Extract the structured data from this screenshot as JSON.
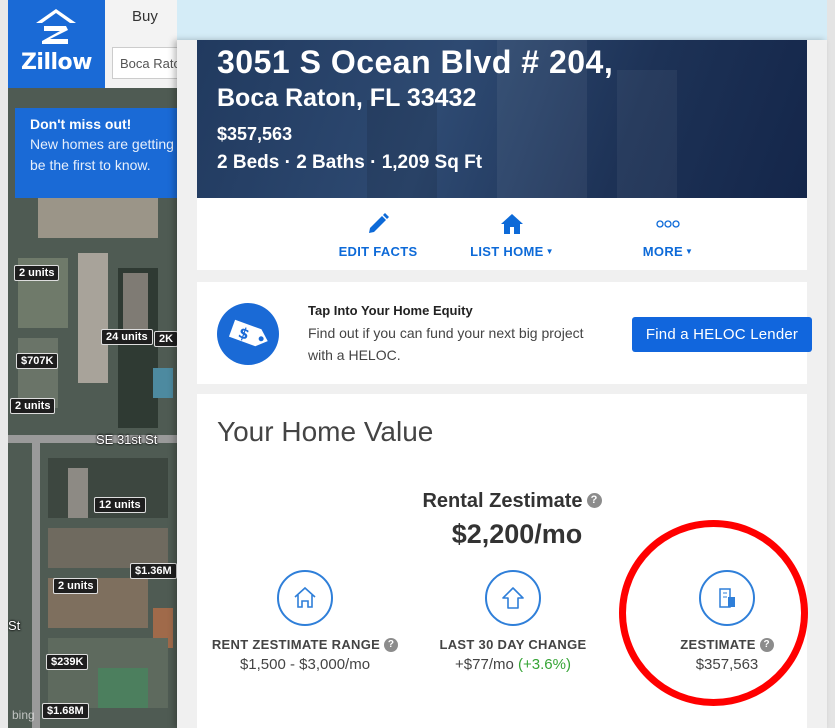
{
  "app": {
    "logo_text": "Zillow",
    "nav_buy": "Buy",
    "search_value": "Boca Raton, FL",
    "brand_color": "#1a6ad6"
  },
  "map": {
    "promo": {
      "title": "Don't miss out!",
      "line1": "New homes are getting listed!",
      "line2": "be the first to know."
    },
    "labels": [
      "2 units",
      "24 units",
      "2K",
      "$707K",
      "2 units",
      "12 units",
      "2 units",
      "$1.36M",
      "$239K",
      "$1.68M"
    ],
    "streets": [
      "SE 31st St",
      "St"
    ],
    "attribution": "bing"
  },
  "property": {
    "address_line1": "3051 S Ocean Blvd # 204,",
    "address_line2": "Boca Raton, FL 33432",
    "price": "$357,563",
    "facts": "2 Beds · 2 Baths · 1,209 Sq Ft"
  },
  "actions": [
    {
      "label": "EDIT FACTS",
      "icon": "pencil-icon"
    },
    {
      "label": "LIST HOME",
      "icon": "house-icon"
    },
    {
      "label": "MORE",
      "icon": "dots-icon"
    }
  ],
  "heloc": {
    "title": "Tap Into Your Home Equity",
    "body": "Find out if you can fund your next big project with a HELOC.",
    "button": "Find a HELOC Lender"
  },
  "home_value": {
    "title": "Your Home Value",
    "rental_label": "Rental Zestimate",
    "rental_value": "$2,200/mo",
    "help_glyph": "?",
    "stats": [
      {
        "label": "RENT ZESTIMATE RANGE",
        "value": "$1,500 - $3,000/mo",
        "icon": "house-outline-icon"
      },
      {
        "label": "LAST 30 DAY CHANGE",
        "value": "+$77/mo",
        "change": "(+3.6%)",
        "icon": "arrow-up-icon"
      },
      {
        "label": "ZESTIMATE",
        "value": "$357,563",
        "icon": "building-icon"
      }
    ]
  },
  "colors": {
    "accent": "#0d6ad8",
    "positive": "#35a435",
    "annotation": "#ff0000"
  }
}
